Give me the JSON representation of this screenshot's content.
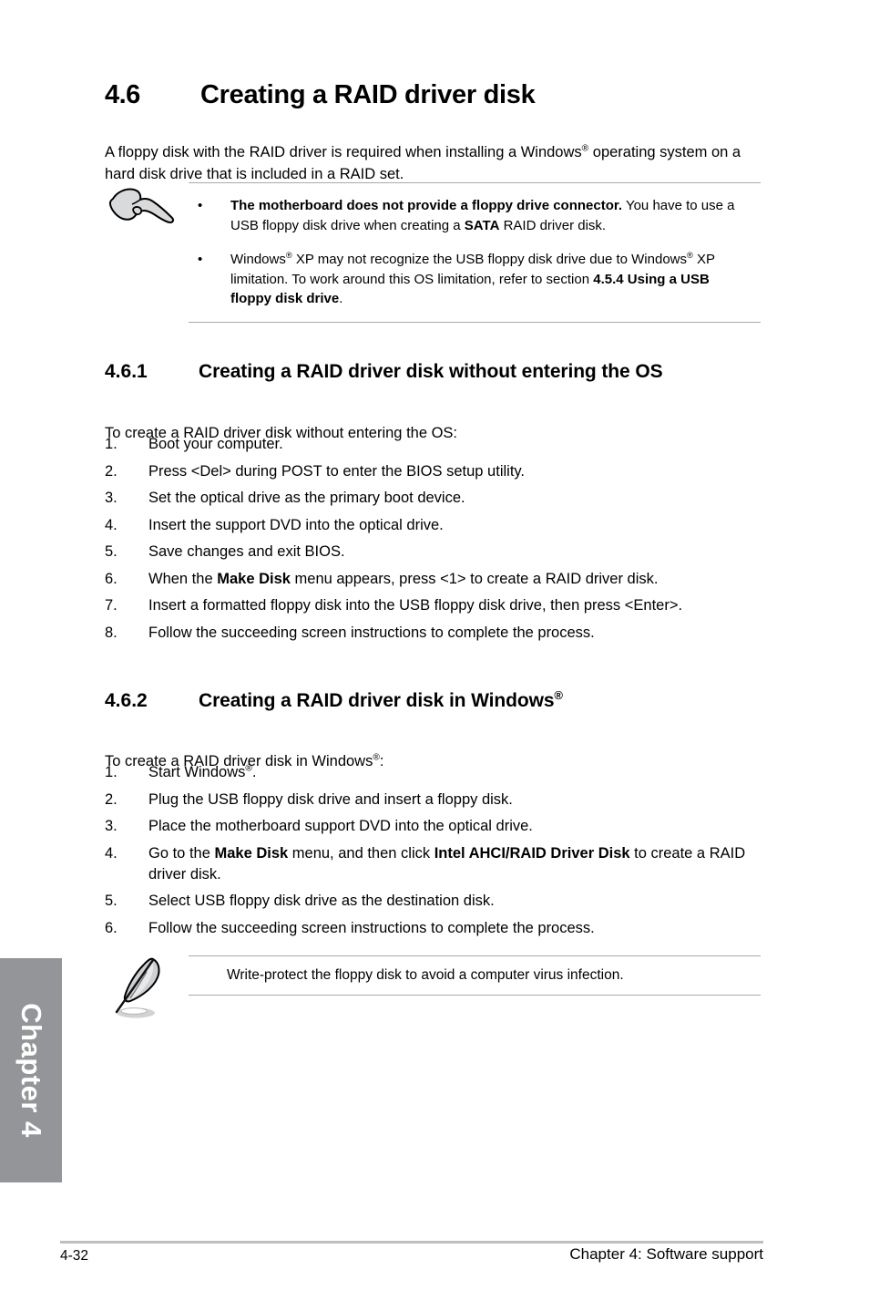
{
  "chapter_tab": {
    "label": "Chapter 4"
  },
  "section": {
    "number": "4.6",
    "title": "Creating a RAID driver disk",
    "intro_part1": "A floppy disk with the RAID driver is required when installing a Windows",
    "intro_reg": "®",
    "intro_part2": " operating system on a hard disk drive that is included in a RAID set."
  },
  "note_top": {
    "icon": "pointing-hand-icon",
    "bullets": [
      {
        "marker": "•",
        "bold_lead": "The motherboard does not provide a floppy drive connector.",
        "text_mid": " You have to use a USB floppy disk drive when creating a ",
        "bold_inline": "SATA",
        "text_tail": " RAID driver disk."
      },
      {
        "marker": "•",
        "text_a": "Windows",
        "reg1": "®",
        "text_b": " XP may not recognize the USB floppy disk drive due to Windows",
        "reg2": "®",
        "text_c": " XP limitation. To work around this OS limitation, refer to section ",
        "bold_ref": "4.5.4 Using a USB floppy disk drive",
        "text_d": "."
      }
    ]
  },
  "subsection_1": {
    "number": "4.6.1",
    "title": "Creating a RAID driver disk without entering the OS",
    "lead": "To create a RAID driver disk without entering the OS:",
    "steps": [
      {
        "n": "1.",
        "pre": "Boot your computer.",
        "bold": "",
        "post": ""
      },
      {
        "n": "2.",
        "pre": "Press <Del> during POST to enter the BIOS setup utility.",
        "bold": "",
        "post": ""
      },
      {
        "n": "3.",
        "pre": "Set the optical drive as the primary boot device.",
        "bold": "",
        "post": ""
      },
      {
        "n": "4.",
        "pre": "Insert the support DVD into the optical drive.",
        "bold": "",
        "post": ""
      },
      {
        "n": "5.",
        "pre": "Save changes and exit BIOS.",
        "bold": "",
        "post": ""
      },
      {
        "n": "6.",
        "pre": "When the ",
        "bold": "Make Disk",
        "post": " menu appears, press <1> to create a RAID driver disk."
      },
      {
        "n": "7.",
        "pre": "Insert a formatted floppy disk into the USB floppy disk drive, then press <Enter>.",
        "bold": "",
        "post": ""
      },
      {
        "n": "8.",
        "pre": "Follow the succeeding screen instructions to complete the process.",
        "bold": "",
        "post": ""
      }
    ]
  },
  "subsection_2": {
    "number": "4.6.2",
    "title_text": "Creating a RAID driver disk in Windows",
    "title_reg": "®",
    "lead_a": "To create a RAID driver disk in Windows",
    "lead_reg": "®",
    "lead_b": ":",
    "steps": [
      {
        "n": "1.",
        "pre": "Start Windows",
        "reg": "®",
        "post": ".",
        "bold": "",
        "bold2": "",
        "mid": ""
      },
      {
        "n": "2.",
        "pre": "Plug the USB floppy disk drive and insert a floppy disk.",
        "reg": "",
        "post": "",
        "bold": "",
        "bold2": "",
        "mid": ""
      },
      {
        "n": "3.",
        "pre": "Place the motherboard support DVD into the optical drive.",
        "reg": "",
        "post": "",
        "bold": "",
        "bold2": "",
        "mid": ""
      },
      {
        "n": "4.",
        "pre": "Go to the ",
        "reg": "",
        "bold": "Make Disk",
        "mid": " menu, and then click ",
        "bold2": "Intel AHCI/RAID Driver Disk",
        "post": " to create a RAID driver disk."
      },
      {
        "n": "5.",
        "pre": "Select USB floppy disk drive as the destination disk.",
        "reg": "",
        "post": "",
        "bold": "",
        "bold2": "",
        "mid": ""
      },
      {
        "n": "6.",
        "pre": "Follow the succeeding screen instructions to complete the process.",
        "reg": "",
        "post": "",
        "bold": "",
        "bold2": "",
        "mid": ""
      }
    ]
  },
  "note_bottom": {
    "icon": "feather-pen-icon",
    "text": "Write-protect the floppy disk to avoid a computer virus infection."
  },
  "footer": {
    "page_number": "4-32",
    "chapter_label": "Chapter 4: Software support"
  },
  "colors": {
    "tab_gray": "#939598",
    "rule_gray": "#a7a9ac",
    "footer_rule": "#bcbec0",
    "text": "#000000"
  }
}
